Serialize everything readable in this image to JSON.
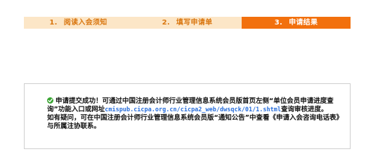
{
  "steps": [
    {
      "number": "1.",
      "label": "阅读入会须知",
      "active": false
    },
    {
      "number": "2.",
      "label": "填写申请单",
      "active": false
    },
    {
      "number": "3.",
      "label": "申请结果",
      "active": true
    }
  ],
  "result": {
    "text_before_link": "申请提交成功！可通过中国注册会计师行业管理信息系统会员版首页左侧“单位会员申请进度查询”功能入口或网址",
    "link_text": "cmispub.cicpa.org.cn/cicpa2_web/dwsqck/01/1.shtml",
    "text_after_link": "查询审核进度。",
    "followup_text": "如有疑问，可在中国注册会计师行业管理信息系统会员版“通知公告”中查看《申请入会咨询电话表》与所属注协联系。"
  },
  "icons": {
    "success": "check-circle-icon"
  },
  "colors": {
    "step_inactive_bg": "#fce6c7",
    "step_inactive_text": "#d9760f",
    "step_active_bg": "#f2700d",
    "step_active_text": "#ffffff",
    "success_icon": "#3aa533",
    "link": "#2a6fdb"
  }
}
